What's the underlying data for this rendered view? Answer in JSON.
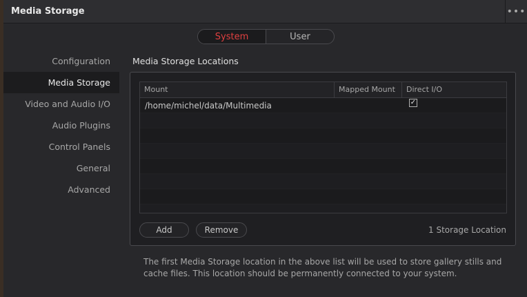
{
  "window": {
    "title": "Media Storage",
    "menu_glyph": "•••"
  },
  "tabs": [
    {
      "label": "System",
      "active": true
    },
    {
      "label": "User",
      "active": false
    }
  ],
  "sidebar": {
    "items": [
      {
        "label": "Configuration",
        "active": false
      },
      {
        "label": "Media Storage",
        "active": true
      },
      {
        "label": "Video and Audio I/O",
        "active": false
      },
      {
        "label": "Audio Plugins",
        "active": false
      },
      {
        "label": "Control Panels",
        "active": false
      },
      {
        "label": "General",
        "active": false
      },
      {
        "label": "Advanced",
        "active": false
      }
    ]
  },
  "main": {
    "section_title": "Media Storage Locations",
    "table": {
      "columns": [
        "Mount",
        "Mapped Mount",
        "Direct I/O"
      ],
      "rows": [
        {
          "mount": "/home/michel/data/Multimedia",
          "mapped_mount": "",
          "direct_io": true,
          "check_glyph": "✓"
        }
      ]
    },
    "add_label": "Add",
    "remove_label": "Remove",
    "location_count": "1 Storage Location",
    "footnote": "The first Media Storage location in the above list will be used to store gallery stills and cache files. This location should be permanently connected to your system."
  },
  "colors": {
    "accent": "#e04040",
    "background": "#28282b"
  }
}
